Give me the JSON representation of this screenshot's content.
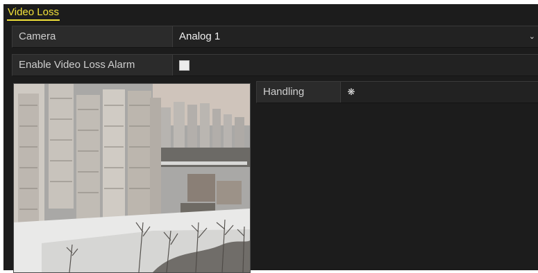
{
  "window": {
    "title": "Video Loss"
  },
  "form": {
    "camera_label": "Camera",
    "camera_value": "Analog 1",
    "enable_label": "Enable Video Loss Alarm",
    "enable_checked": false
  },
  "handling": {
    "label": "Handling",
    "settings_icon": "gear-icon"
  },
  "colors": {
    "title_accent": "#f2e23a",
    "panel_background": "#1c1c1c"
  }
}
